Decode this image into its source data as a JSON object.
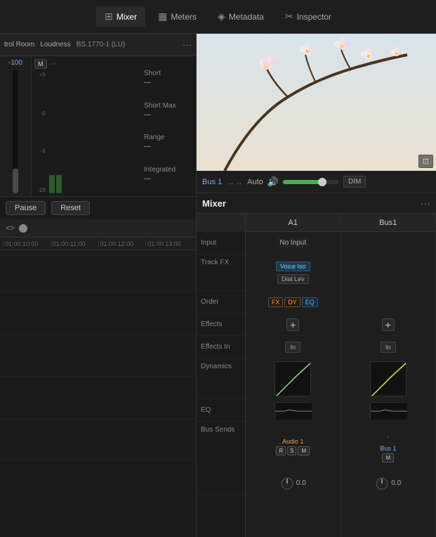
{
  "nav": {
    "items": [
      {
        "id": "mixer",
        "label": "Mixer",
        "icon": "⊞",
        "active": true
      },
      {
        "id": "meters",
        "label": "Meters",
        "icon": "▦",
        "active": false
      },
      {
        "id": "metadata",
        "label": "Metadata",
        "icon": "◈",
        "active": false
      },
      {
        "id": "inspector",
        "label": "Inspector",
        "icon": "✂",
        "active": false
      }
    ]
  },
  "control_room": {
    "label": "trol Room",
    "loudness_label": "Loudness",
    "loudness_standard": "BS.1770-1 (LU)",
    "fader_value": "-100",
    "mono_label": "M",
    "meter_scales": [
      "+9",
      "0",
      "-9",
      "-18"
    ],
    "stats": [
      {
        "label": "Short",
        "value": "—"
      },
      {
        "label": "Short Max",
        "value": "—"
      },
      {
        "label": "Range",
        "value": "—"
      },
      {
        "label": "Integrated",
        "value": "—"
      }
    ],
    "pause_label": "Pause",
    "reset_label": "Reset"
  },
  "bus": {
    "label": "Bus 1",
    "arrow": "→",
    "auto_label": "Auto",
    "dim_label": "DIM",
    "volume": 70
  },
  "timeline": {
    "marks": [
      "01:00:10:00",
      "01:00:11:00",
      "01:00:12:00",
      "01:00:13:00"
    ]
  },
  "mixer": {
    "title": "Mixer",
    "more_icon": "···",
    "channels": [
      {
        "id": "a1",
        "label": "A1"
      },
      {
        "id": "bus1",
        "label": "Bus1"
      }
    ],
    "rows": [
      {
        "id": "input",
        "label": "Input"
      },
      {
        "id": "track_fx",
        "label": "Track FX"
      },
      {
        "id": "order",
        "label": "Order"
      },
      {
        "id": "effects",
        "label": "Effects"
      },
      {
        "id": "effects_in",
        "label": "Effects In"
      },
      {
        "id": "dynamics",
        "label": "Dynamics"
      },
      {
        "id": "eq",
        "label": "EQ"
      },
      {
        "id": "bus_sends",
        "label": "Bus Sends"
      },
      {
        "id": "pan",
        "label": ""
      }
    ],
    "a1": {
      "input": "No Input",
      "track_fx_1": "Voice Iso",
      "track_fx_2": "Dial Lev",
      "order_fx": "FX",
      "order_dy": "DY",
      "order_eq": "EQ",
      "bus_send_name": "Audio 1",
      "pan_value": "0.0"
    },
    "bus1": {
      "input": "",
      "bus_send_name": "Bus 1",
      "pan_value": "0.0"
    }
  }
}
